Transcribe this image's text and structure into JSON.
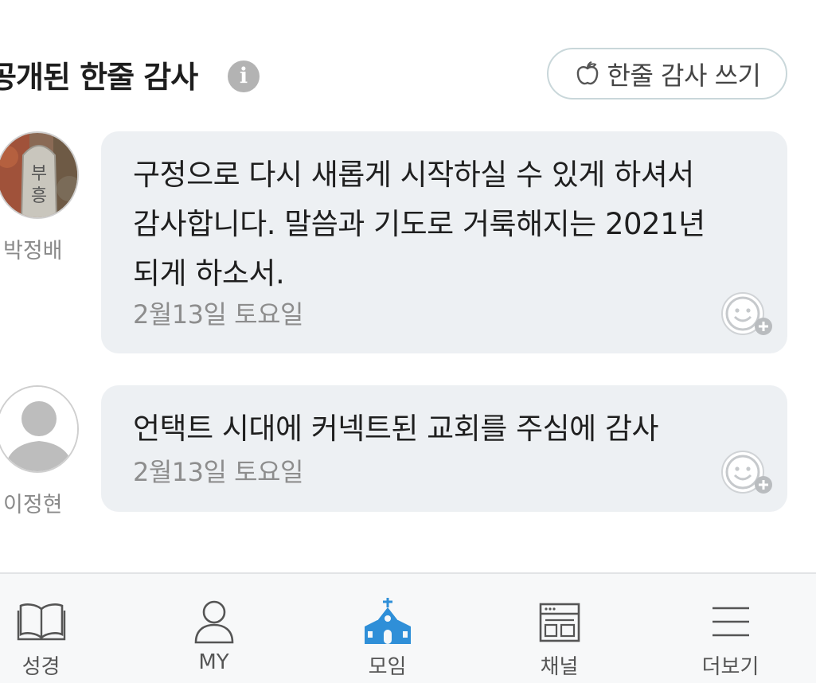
{
  "section": {
    "title": "공개된 한줄 감사",
    "info_icon": "info-icon",
    "write_button_label": "한줄 감사 쓰기",
    "write_button_icon": "apple-icon"
  },
  "posts": [
    {
      "author": "박정배",
      "avatar": "photo-stone-marker",
      "lines": [
        "구정으로 다시 새롭게 시작하실 수 있게 하셔서",
        "감사합니다. 말씀과 기도로 거룩해지는 2021년",
        "되게 하소서."
      ],
      "date": "2월13일 토요일"
    },
    {
      "author": "이정현",
      "avatar": "default-person-silhouette",
      "lines": [
        "언택트 시대에 커넥트된 교회를 주심에 감사"
      ],
      "date": "2월13일 토요일"
    }
  ],
  "bottom_nav": {
    "items": [
      {
        "label": "성경",
        "icon": "book-icon"
      },
      {
        "label": "MY",
        "icon": "person-icon"
      },
      {
        "label": "모임",
        "icon": "church-icon",
        "active": true
      },
      {
        "label": "채널",
        "icon": "channel-icon"
      },
      {
        "label": "더보기",
        "icon": "menu-icon"
      }
    ]
  },
  "colors": {
    "active_nav": "#2f8fd8",
    "bubble_bg": "#edf0f3",
    "nav_bg": "#f7f8f9"
  }
}
